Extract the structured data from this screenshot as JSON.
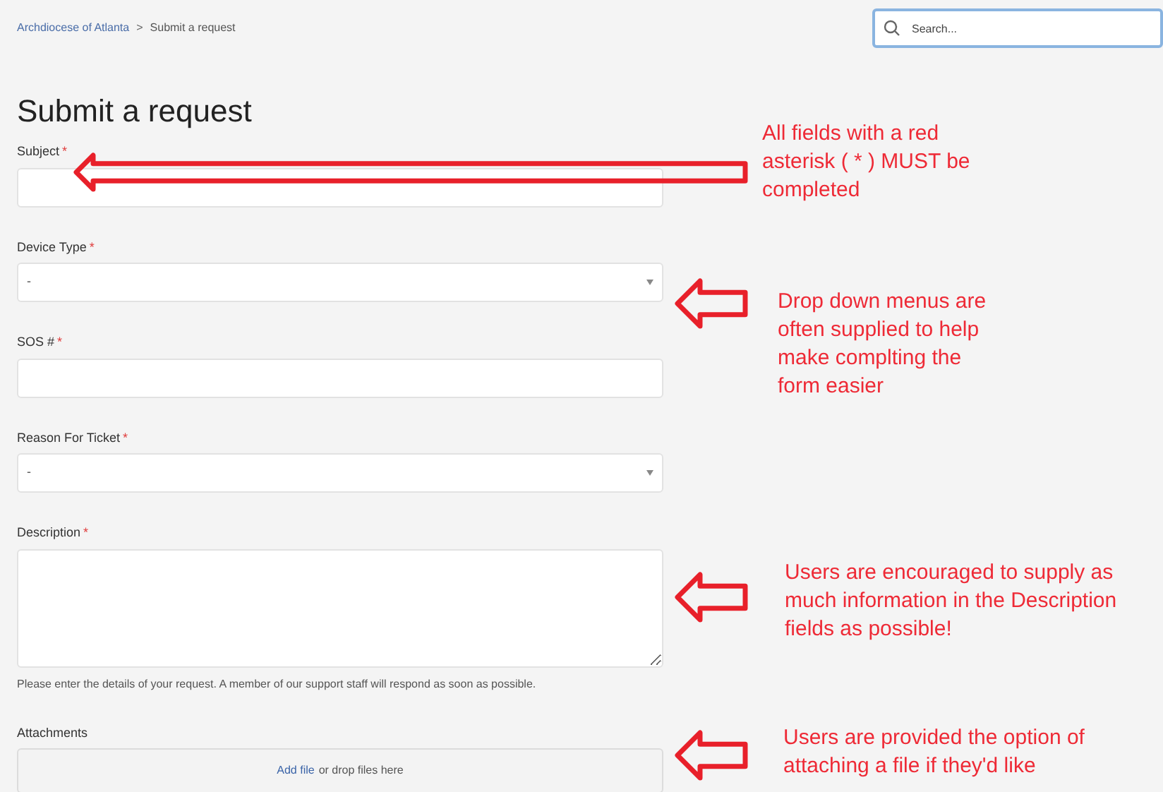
{
  "breadcrumb": [
    {
      "label": "Archdiocese of Atlanta",
      "kind": "link"
    },
    {
      "label": ">",
      "kind": "separator"
    },
    {
      "label": "Submit a request",
      "kind": "current"
    }
  ],
  "search": {
    "placeholder": "Search..."
  },
  "title": "Submit a request",
  "fields": [
    {
      "label": "Subject",
      "required_mark": "*",
      "kind": "text"
    },
    {
      "label": "Device Type",
      "required_mark": "*",
      "kind": "select",
      "value": "-"
    },
    {
      "label": "SOS #",
      "required_mark": "*",
      "kind": "text"
    },
    {
      "label": "Reason For Ticket",
      "required_mark": "*",
      "kind": "select",
      "value": "-"
    },
    {
      "label": "Description",
      "required_mark": "*",
      "kind": "textarea",
      "hint": "Please enter the details of your request. A member of our support staff will respond as soon as possible."
    },
    {
      "label": "Attachments",
      "kind": "file",
      "link": "Add file",
      "rest": "or drop files here"
    }
  ],
  "annotations": [
    {
      "text": "All fields with a red asterisk ( * ) MUST be completed",
      "kind": "long"
    },
    {
      "text": "Drop down menus are often supplied to help make complting the form easier",
      "kind": "short"
    },
    {
      "text": "Users are encouraged to supply as much information in the Description fields as possible!",
      "kind": "short"
    },
    {
      "text": "Users are provided the option of attaching a file if they'd like",
      "kind": "short"
    }
  ]
}
